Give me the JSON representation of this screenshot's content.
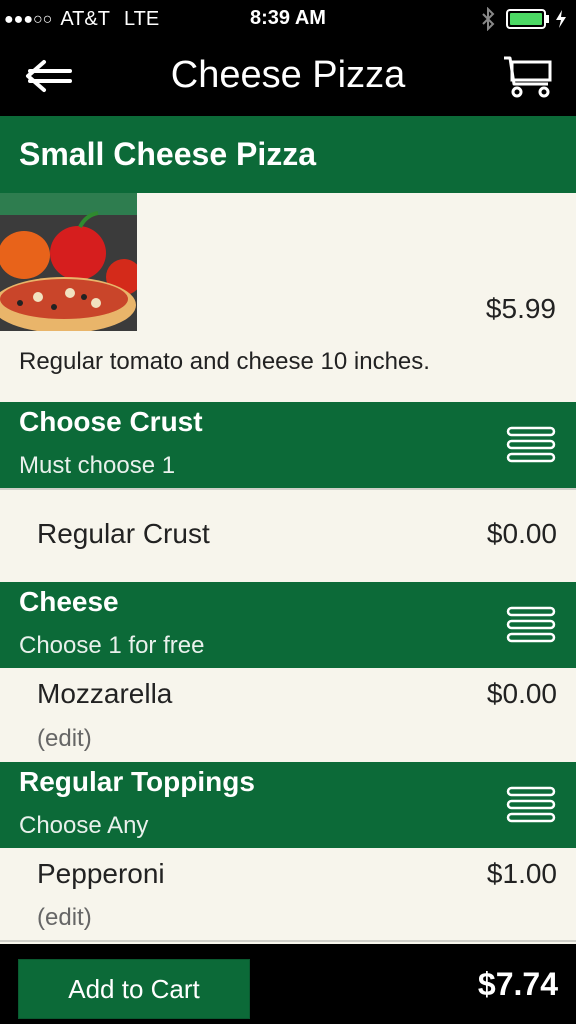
{
  "status": {
    "signal": "●●●○○",
    "carrier": "AT&T",
    "network": "LTE",
    "time": "8:39 AM"
  },
  "nav": {
    "title": "Cheese Pizza"
  },
  "item": {
    "name": "Small Cheese Pizza",
    "price": "$5.99",
    "description": "Regular tomato and cheese 10 inches."
  },
  "sections": [
    {
      "title": "Choose Crust",
      "subtitle": "Must choose 1",
      "options": [
        {
          "name": "Regular Crust",
          "price": "$0.00"
        }
      ]
    },
    {
      "title": "Cheese",
      "subtitle": "Choose 1 for free",
      "options": [
        {
          "name": "Mozzarella",
          "price": "$0.00",
          "edit": "(edit)"
        }
      ]
    },
    {
      "title": "Regular Toppings",
      "subtitle": "Choose Any",
      "options": [
        {
          "name": "Pepperoni",
          "price": "$1.00",
          "edit": "(edit)"
        }
      ]
    }
  ],
  "footer": {
    "add_label": "Add to Cart",
    "total": "$7.74"
  },
  "colors": {
    "green": "#0c6a38",
    "bar": "#000000",
    "background": "#f7f5ec",
    "battery": "#4cd964"
  },
  "icons": [
    "back-arrow-icon",
    "cart-icon",
    "bluetooth-icon",
    "battery-icon",
    "menu-lines-icon"
  ]
}
